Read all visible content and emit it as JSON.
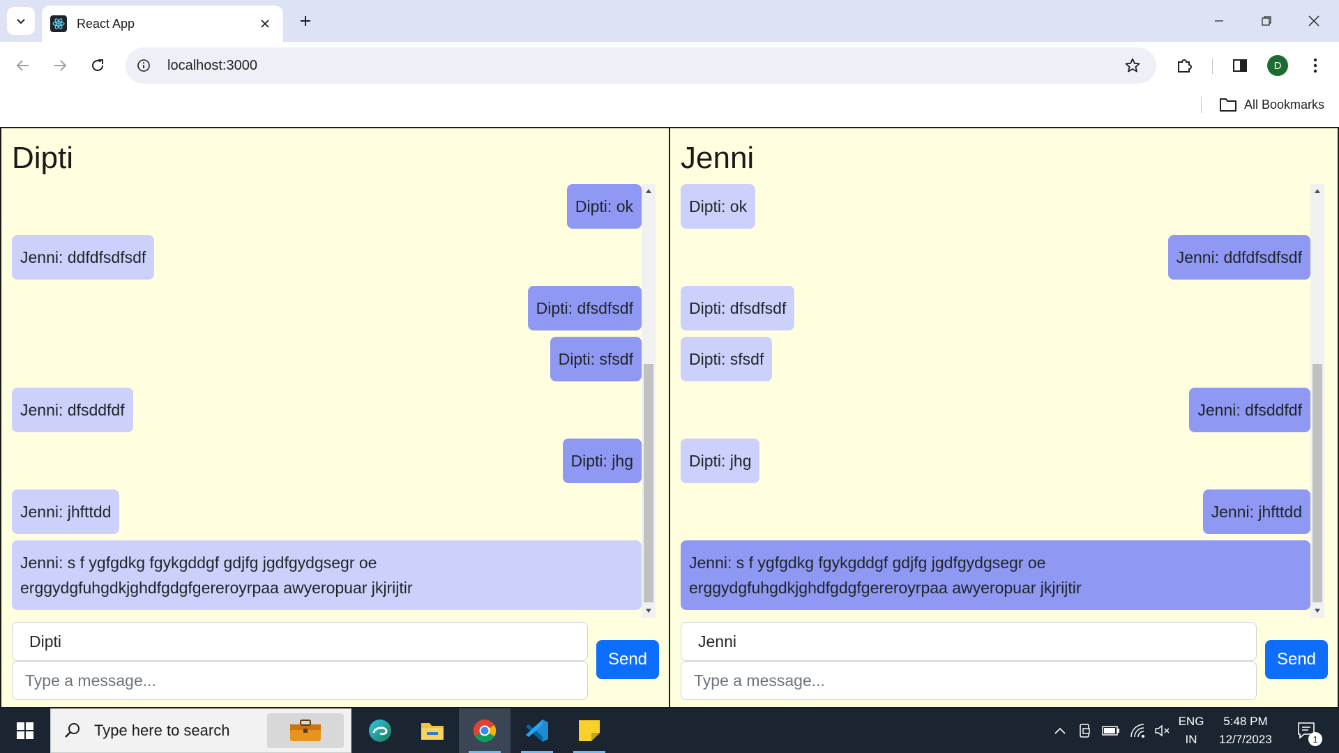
{
  "browser": {
    "tab_title": "React App",
    "url": "localhost:3000",
    "profile_initial": "D",
    "bookmarks_label": "All Bookmarks"
  },
  "panels": [
    {
      "title": "Dipti",
      "name_value": "Dipti",
      "message_placeholder": "Type a message...",
      "send_label": "Send",
      "messages": [
        {
          "text": "Dipti: ok",
          "side": "right",
          "style": "dark"
        },
        {
          "text": "Jenni: ddfdfsdfsdf",
          "side": "left",
          "style": "light"
        },
        {
          "text": "Dipti: dfsdfsdf",
          "side": "right",
          "style": "dark"
        },
        {
          "text": "Dipti: sfsdf",
          "side": "right",
          "style": "dark"
        },
        {
          "text": "Jenni: dfsddfdf",
          "side": "left",
          "style": "light"
        },
        {
          "text": "Dipti: jhg",
          "side": "right",
          "style": "dark"
        },
        {
          "text": "Jenni: jhfttdd",
          "side": "left",
          "style": "light"
        },
        {
          "text": "Jenni: s f ygfgdkg fgykgddgf gdjfg jgdfgydgsegr oe erggydgfuhgdkjghdfgdgfgereroyrpaa awyeropuar jkjrijtir",
          "side": "left",
          "style": "light"
        }
      ]
    },
    {
      "title": "Jenni",
      "name_value": "Jenni",
      "message_placeholder": "Type a message...",
      "send_label": "Send",
      "messages": [
        {
          "text": "Dipti: ok",
          "side": "left",
          "style": "light"
        },
        {
          "text": "Jenni: ddfdfsdfsdf",
          "side": "right",
          "style": "dark"
        },
        {
          "text": "Dipti: dfsdfsdf",
          "side": "left",
          "style": "light"
        },
        {
          "text": "Dipti: sfsdf",
          "side": "left",
          "style": "light"
        },
        {
          "text": "Jenni: dfsddfdf",
          "side": "right",
          "style": "dark"
        },
        {
          "text": "Dipti: jhg",
          "side": "left",
          "style": "light"
        },
        {
          "text": "Jenni: jhfttdd",
          "side": "right",
          "style": "dark"
        },
        {
          "text": "Jenni: s f ygfgdkg fgykgddgf gdjfg jgdfgydgsegr oe erggydgfuhgdkjghdfgdgfgereroyrpaa awyeropuar jkjrijtir",
          "side": "right",
          "style": "dark"
        }
      ]
    }
  ],
  "colors": {
    "bubble_light": "#ccd1fb",
    "bubble_dark": "#8f98f3",
    "send_button": "#0d6efd",
    "panel_bg": "#ffffe0"
  },
  "taskbar": {
    "search_placeholder": "Type here to search",
    "language": "ENG",
    "region": "IN",
    "time": "5:48 PM",
    "date": "12/7/2023",
    "notification_count": "1"
  }
}
